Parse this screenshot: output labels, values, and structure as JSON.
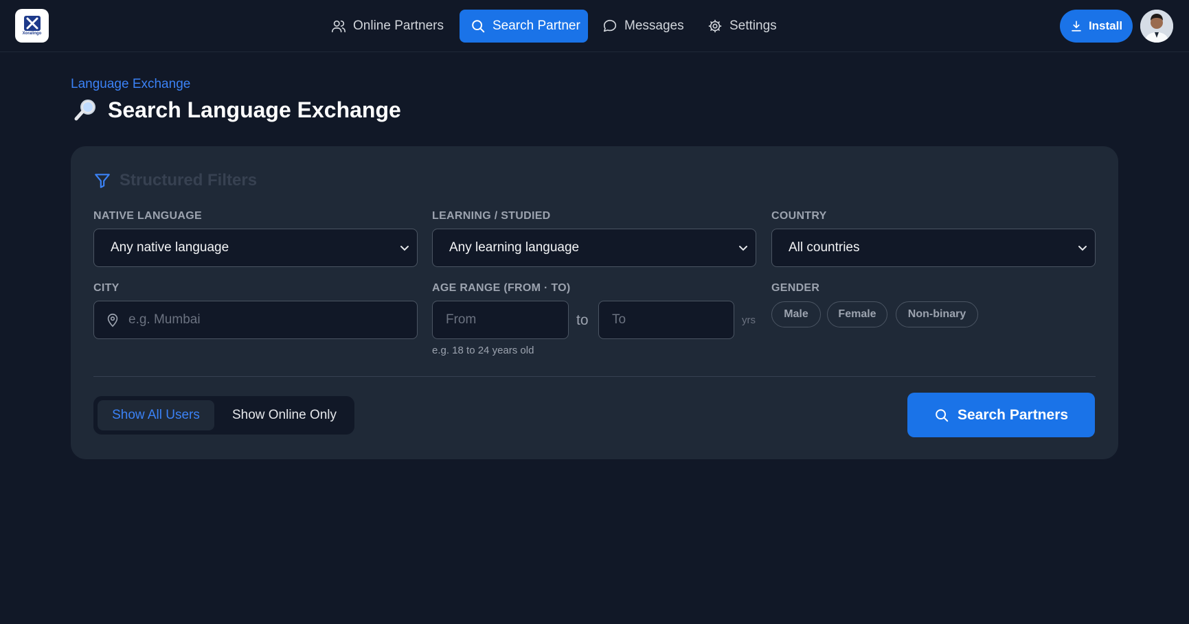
{
  "brand": {
    "logo_text": "Xoralingo"
  },
  "nav": {
    "items": [
      {
        "label": "Online Partners",
        "icon": "users-icon"
      },
      {
        "label": "Search Partner",
        "icon": "search-icon",
        "active": true
      },
      {
        "label": "Messages",
        "icon": "chat-bubble-icon"
      },
      {
        "label": "Settings",
        "icon": "gear-icon"
      }
    ]
  },
  "header": {
    "install_label": "Install",
    "install_icon": "download-icon",
    "avatar": "user-avatar"
  },
  "page": {
    "breadcrumb": "Language Exchange",
    "title": "Search Language Exchange",
    "title_icon": "magnifying-glass-emoji"
  },
  "filters": {
    "heading": "Structured Filters",
    "heading_icon": "filter-icon",
    "native_language": {
      "label": "NATIVE LANGUAGE",
      "value": "Any native language"
    },
    "learning": {
      "label": "LEARNING / STUDIED",
      "value": "Any learning language"
    },
    "country": {
      "label": "COUNTRY",
      "value": "All countries"
    },
    "city": {
      "label": "CITY",
      "placeholder": "e.g. Mumbai",
      "icon": "map-pin-icon"
    },
    "age_range": {
      "label": "AGE RANGE (FROM · TO)",
      "from_placeholder": "From",
      "separator": "to",
      "to_placeholder": "To",
      "unit": "yrs",
      "hint": "e.g. 18 to 24 years old"
    },
    "gender": {
      "label": "GENDER",
      "options": [
        "Male",
        "Female",
        "Non-binary"
      ]
    }
  },
  "view_toggle": {
    "options": [
      "Show All Users",
      "Show Online Only"
    ],
    "selected": "Show All Users"
  },
  "actions": {
    "search_label": "Search Partners"
  },
  "colors": {
    "accent": "#1a73e8",
    "background": "#111827",
    "card": "#1f2937",
    "link": "#3b82f6"
  }
}
